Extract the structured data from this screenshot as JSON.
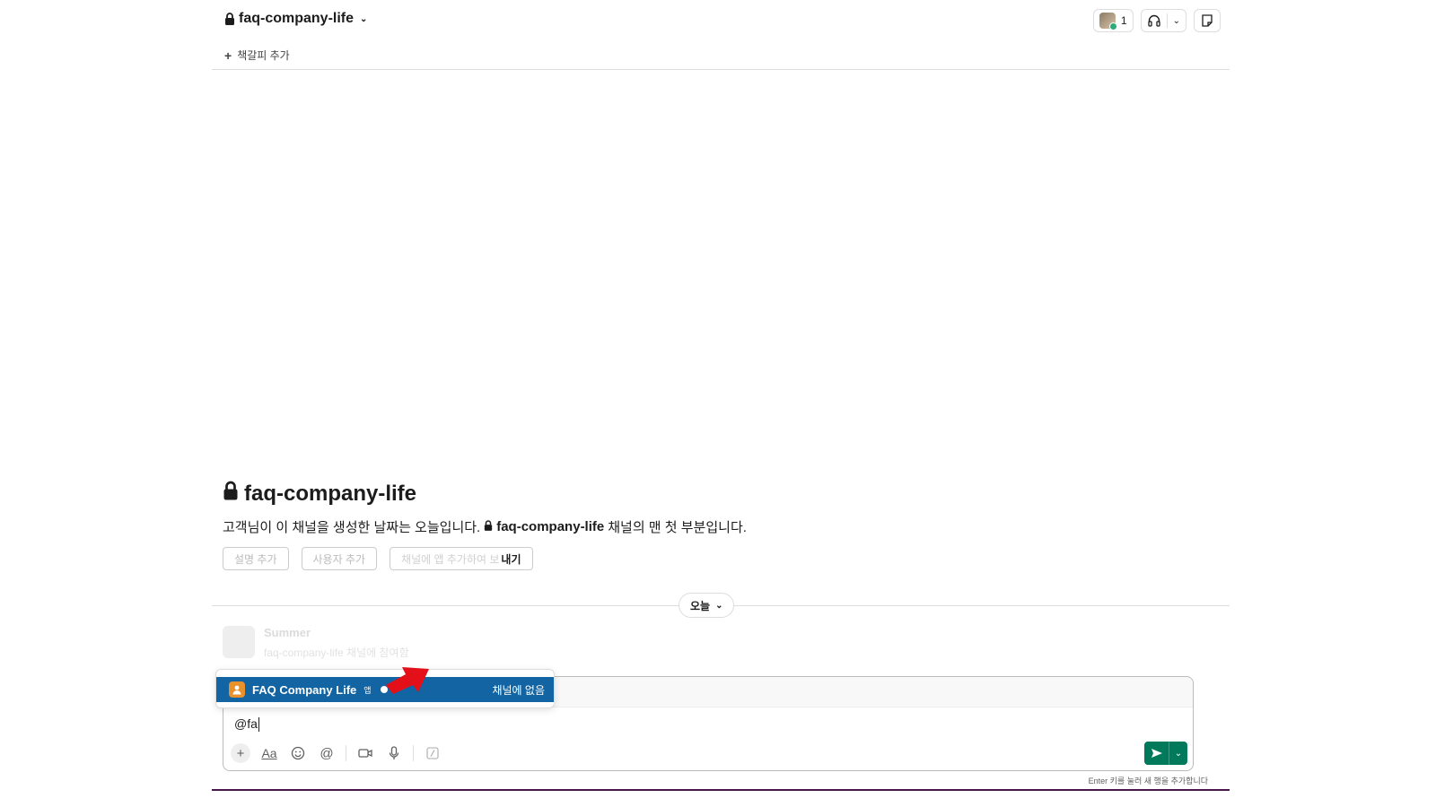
{
  "header": {
    "channel_name": "faq-company-life",
    "bookmark_label": "책갈피 추가",
    "member_count": "1"
  },
  "intro": {
    "title": "faq-company-life",
    "desc_prefix": "고객님이 이 채널을 생성한 날짜는 오늘입니다.",
    "desc_channel": "faq-company-life",
    "desc_suffix": "채널의 맨 첫 부분입니다."
  },
  "actions": {
    "faded_1": "설명 추가",
    "faded_2": "사용자 추가",
    "faded_3": "채널에 앱 추가하여 보",
    "last_visible": "내기"
  },
  "divider": {
    "today_label": "오늘"
  },
  "ghost_message": {
    "author": "Summer",
    "text": "faq-company-life 채널에 참여함"
  },
  "mention_popup": {
    "name": "FAQ Company Life",
    "app_tag": "앱",
    "note": "채널에 없음"
  },
  "composer": {
    "text": "@fa",
    "hint": "Enter 키를 눌러 새 행을 추가합니다"
  },
  "colors": {
    "selected_row": "#1264a3",
    "send_button": "#007a5a",
    "arrow": "#e3101a",
    "app_avatar": "#e8912d"
  }
}
